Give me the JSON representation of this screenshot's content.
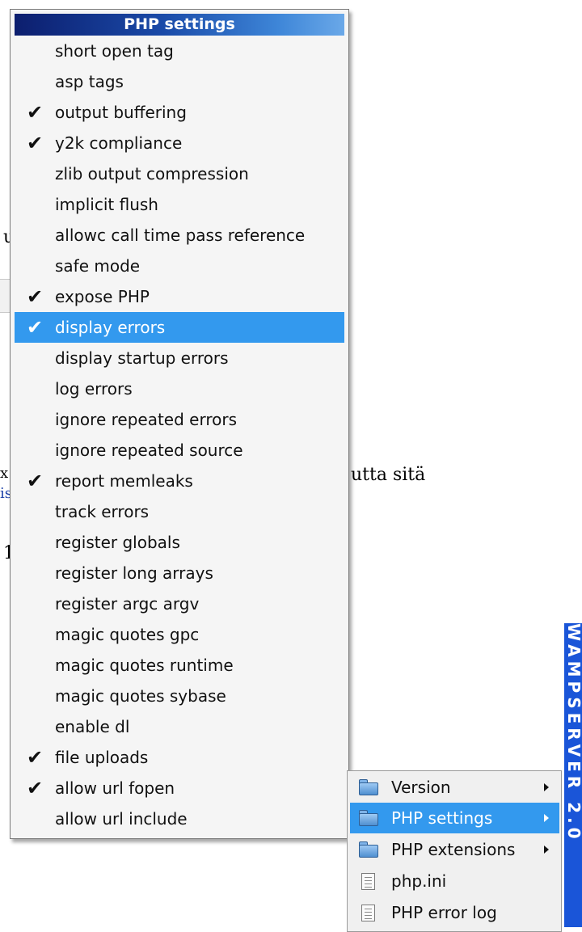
{
  "php_menu": {
    "title": "PHP settings",
    "items": [
      {
        "label": "short open tag",
        "checked": false
      },
      {
        "label": "asp tags",
        "checked": false
      },
      {
        "label": "output buffering",
        "checked": true
      },
      {
        "label": "y2k compliance",
        "checked": true
      },
      {
        "label": "zlib output compression",
        "checked": false
      },
      {
        "label": "implicit flush",
        "checked": false
      },
      {
        "label": "allowc call time pass reference",
        "checked": false
      },
      {
        "label": "safe mode",
        "checked": false
      },
      {
        "label": "expose PHP",
        "checked": true
      },
      {
        "label": "display errors",
        "checked": true,
        "selected": true
      },
      {
        "label": "display startup errors",
        "checked": false
      },
      {
        "label": "log errors",
        "checked": false
      },
      {
        "label": "ignore repeated errors",
        "checked": false
      },
      {
        "label": "ignore repeated source",
        "checked": false
      },
      {
        "label": "report memleaks",
        "checked": true
      },
      {
        "label": "track errors",
        "checked": false
      },
      {
        "label": "register globals",
        "checked": false
      },
      {
        "label": "register long arrays",
        "checked": false
      },
      {
        "label": "register argc argv",
        "checked": false
      },
      {
        "label": "magic quotes gpc",
        "checked": false
      },
      {
        "label": "magic quotes runtime",
        "checked": false
      },
      {
        "label": "magic quotes sybase",
        "checked": false
      },
      {
        "label": "enable dl",
        "checked": false
      },
      {
        "label": "file uploads",
        "checked": true
      },
      {
        "label": "allow url fopen",
        "checked": true
      },
      {
        "label": "allow url include",
        "checked": false
      }
    ]
  },
  "check_glyph": "✔",
  "tray_menu": {
    "items": [
      {
        "label": "Version",
        "icon": "folder-icon",
        "submenu": true
      },
      {
        "label": "PHP settings",
        "icon": "folder-icon",
        "submenu": true,
        "selected": true
      },
      {
        "label": "PHP extensions",
        "icon": "folder-icon",
        "submenu": true
      },
      {
        "label": "php.ini",
        "icon": "document-icon",
        "submenu": false
      },
      {
        "label": "PHP error log",
        "icon": "document-icon",
        "submenu": false
      }
    ]
  },
  "banner": {
    "text": "WAMPSERVER 2.0"
  },
  "background_text": {
    "fragment_1": "u",
    "fragment_2": "utta sitä",
    "fragment_3": "1",
    "fragment_4": "is",
    "fragment_5": "x"
  },
  "colors": {
    "selection": "#3399ee",
    "header_gradient_start": "#0c1e6e",
    "header_gradient_end": "#6aa8e8",
    "banner": "#1a55d8"
  }
}
